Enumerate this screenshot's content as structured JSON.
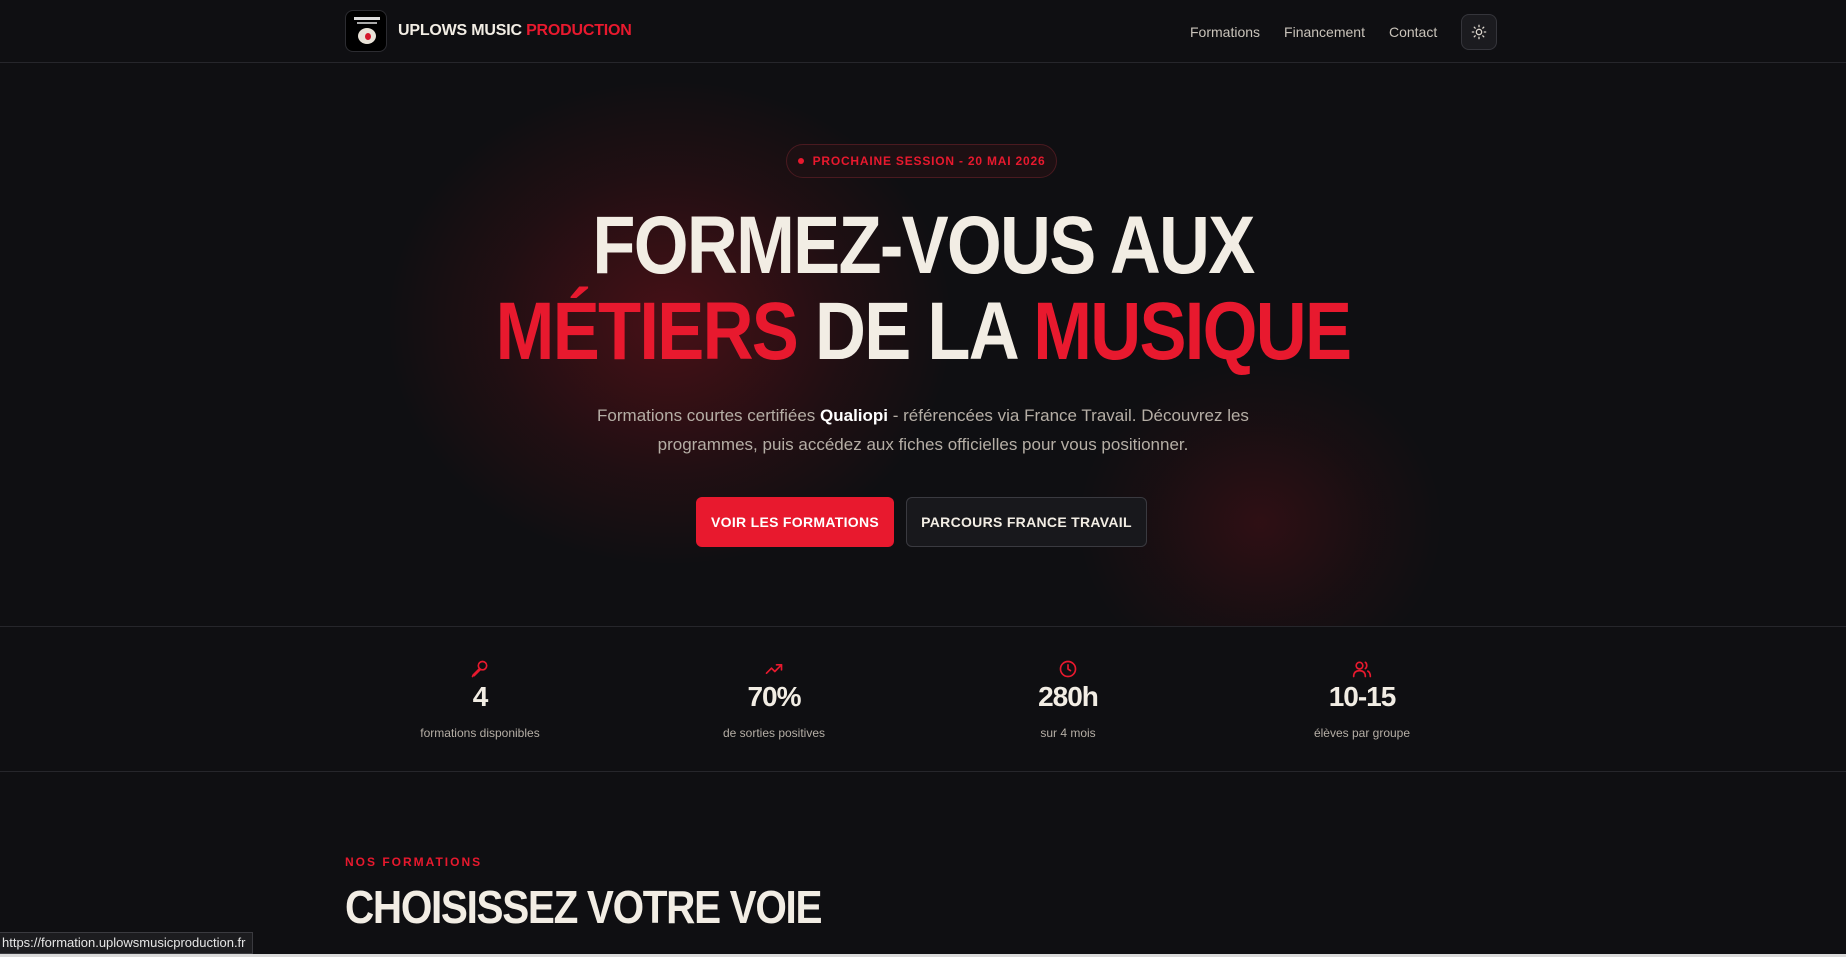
{
  "brand": {
    "name_white": "UPLOWS MUSIC",
    "name_red": "PRODUCTION"
  },
  "nav": {
    "items": [
      {
        "label": "Formations"
      },
      {
        "label": "Financement"
      },
      {
        "label": "Contact"
      }
    ],
    "theme_icon": "sun-icon"
  },
  "hero": {
    "badge": "PROCHAINE SESSION - 20 MAI 2026",
    "headline": {
      "line1": "FORMEZ-VOUS AUX",
      "line2_red1": "MÉTIERS",
      "line2_white": "DE LA",
      "line2_red2": "MUSIQUE"
    },
    "subtitle_pre": "Formations courtes certifiées ",
    "subtitle_bold": "Qualiopi",
    "subtitle_post": " - référencées via France Travail. Découvrez les programmes, puis accédez aux fiches officielles pour vous positionner.",
    "primary_button": "VOIR LES FORMATIONS",
    "secondary_button": "PARCOURS FRANCE TRAVAIL"
  },
  "stats": [
    {
      "icon": "microphone-icon",
      "value": "4",
      "label": "formations disponibles"
    },
    {
      "icon": "trending-up-icon",
      "value": "70%",
      "label": "de sorties positives"
    },
    {
      "icon": "clock-icon",
      "value": "280h",
      "label": "sur 4 mois"
    },
    {
      "icon": "users-icon",
      "value": "10-15",
      "label": "élèves par groupe"
    }
  ],
  "section": {
    "eyebrow": "NOS FORMATIONS",
    "title": "CHOISISSEZ VOTRE VOIE"
  },
  "statusbar": {
    "url": "https://formation.uplowsmusicproduction.fr"
  },
  "colors": {
    "background": "#0f0f12",
    "accent": "#e8192e",
    "text": "#f2ede4",
    "muted": "#b5aea5"
  }
}
